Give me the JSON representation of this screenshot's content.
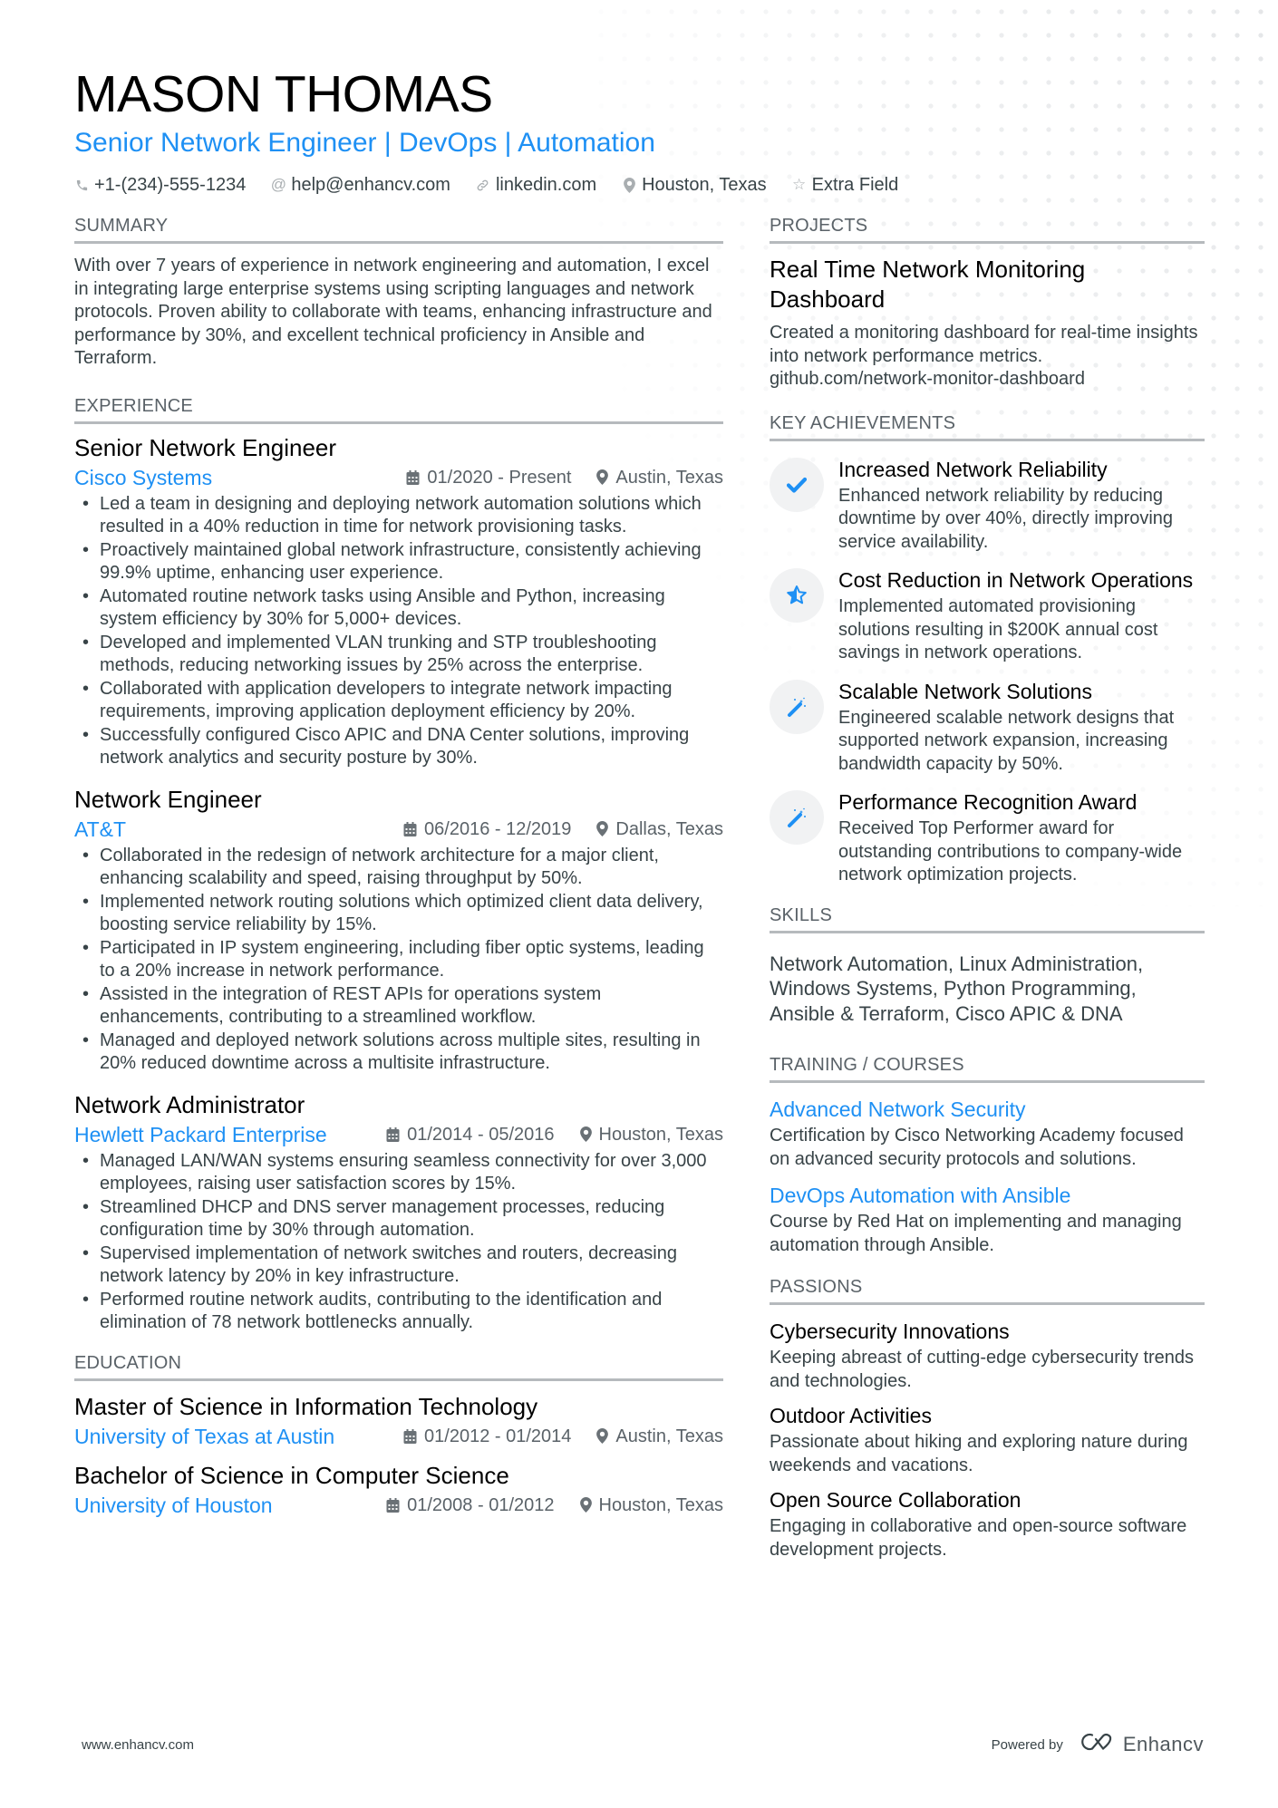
{
  "header": {
    "name": "MASON THOMAS",
    "title": "Senior Network Engineer | DevOps | Automation",
    "contacts": [
      {
        "icon": "phone-icon",
        "text": "+1-(234)-555-1234"
      },
      {
        "icon": "at-icon",
        "text": "help@enhancv.com"
      },
      {
        "icon": "link-icon",
        "text": "linkedin.com"
      },
      {
        "icon": "location-pin-icon",
        "text": "Houston, Texas"
      },
      {
        "icon": "star-outline-icon",
        "text": "Extra Field"
      }
    ]
  },
  "colors": {
    "accent": "#1e90f4",
    "text": "#384347",
    "heading": "#000000",
    "section_rule": "#b6babd",
    "icon_bg": "#f1f2f3"
  },
  "summary": {
    "heading": "Summary",
    "text": "With over 7 years of experience in network engineering and automation, I excel in integrating large enterprise systems using scripting languages and network protocols. Proven ability to collaborate with teams, enhancing infrastructure and performance by 30%, and excellent technical proficiency in Ansible and Terraform."
  },
  "experience": {
    "heading": "Experience",
    "jobs": [
      {
        "title": "Senior Network Engineer",
        "company": "Cisco Systems",
        "dates": "01/2020 - Present",
        "location": "Austin, Texas",
        "bullets": [
          "Led a team in designing and deploying network automation solutions which resulted in a 40% reduction in time for network provisioning tasks.",
          "Proactively maintained global network infrastructure, consistently achieving 99.9% uptime, enhancing user experience.",
          "Automated routine network tasks using Ansible and Python, increasing system efficiency by 30% for 5,000+ devices.",
          "Developed and implemented VLAN trunking and STP troubleshooting methods, reducing networking issues by 25% across the enterprise.",
          "Collaborated with application developers to integrate network impacting requirements, improving application deployment efficiency by 20%.",
          "Successfully configured Cisco APIC and DNA Center solutions, improving network analytics and security posture by 30%."
        ]
      },
      {
        "title": "Network Engineer",
        "company": "AT&T",
        "dates": "06/2016 - 12/2019",
        "location": "Dallas, Texas",
        "bullets": [
          "Collaborated in the redesign of network architecture for a major client, enhancing scalability and speed, raising throughput by 50%.",
          "Implemented network routing solutions which optimized client data delivery, boosting service reliability by 15%.",
          "Participated in IP system engineering, including fiber optic systems, leading to a 20% increase in network performance.",
          "Assisted in the integration of REST APIs for operations system enhancements, contributing to a streamlined workflow.",
          "Managed and deployed network solutions across multiple sites, resulting in 20% reduced downtime across a multisite infrastructure."
        ]
      },
      {
        "title": "Network Administrator",
        "company": "Hewlett Packard Enterprise",
        "dates": "01/2014 - 05/2016",
        "location": "Houston, Texas",
        "bullets": [
          "Managed LAN/WAN systems ensuring seamless connectivity for over 3,000 employees, raising user satisfaction scores by 15%.",
          "Streamlined DHCP and DNS server management processes, reducing configuration time by 30% through automation.",
          "Supervised implementation of network switches and routers, decreasing network latency by 20% in key infrastructure.",
          "Performed routine network audits, contributing to the identification and elimination of 78 network bottlenecks annually."
        ]
      }
    ]
  },
  "education": {
    "heading": "Education",
    "items": [
      {
        "degree": "Master of Science in Information Technology",
        "school": "University of Texas at Austin",
        "dates": "01/2012 - 01/2014",
        "location": "Austin, Texas"
      },
      {
        "degree": "Bachelor of Science in Computer Science",
        "school": "University of Houston",
        "dates": "01/2008 - 01/2012",
        "location": "Houston, Texas"
      }
    ]
  },
  "projects": {
    "heading": "Projects",
    "items": [
      {
        "title": "Real Time Network Monitoring Dashboard",
        "description": "Created a monitoring dashboard for real-time insights into network performance metrics.",
        "link": "github.com/network-monitor-dashboard"
      }
    ]
  },
  "achievements": {
    "heading": "Key Achievements",
    "items": [
      {
        "icon": "checkmark-icon",
        "title": "Increased Network Reliability",
        "description": "Enhanced network reliability by reducing downtime by over 40%, directly improving service availability."
      },
      {
        "icon": "half-star-icon",
        "title": "Cost Reduction in Network Operations",
        "description": "Implemented automated provisioning solutions resulting in $200K annual cost savings in network operations."
      },
      {
        "icon": "magic-wand-icon",
        "title": "Scalable Network Solutions",
        "description": "Engineered scalable network designs that supported network expansion, increasing bandwidth capacity by 50%."
      },
      {
        "icon": "magic-wand-icon",
        "title": "Performance Recognition Award",
        "description": "Received Top Performer award for outstanding contributions to company-wide network optimization projects."
      }
    ]
  },
  "skills": {
    "heading": "Skills",
    "text": "Network Automation, Linux Administration, Windows Systems, Python Programming, Ansible & Terraform, Cisco APIC & DNA"
  },
  "training": {
    "heading": "Training / Courses",
    "items": [
      {
        "title": "Advanced Network Security",
        "description": "Certification by Cisco Networking Academy focused on advanced security protocols and solutions."
      },
      {
        "title": "DevOps Automation with Ansible",
        "description": "Course by Red Hat on implementing and managing automation through Ansible."
      }
    ]
  },
  "passions": {
    "heading": "Passions",
    "items": [
      {
        "title": "Cybersecurity Innovations",
        "description": "Keeping abreast of cutting-edge cybersecurity trends and technologies."
      },
      {
        "title": "Outdoor Activities",
        "description": "Passionate about hiking and exploring nature during weekends and vacations."
      },
      {
        "title": "Open Source Collaboration",
        "description": "Engaging in collaborative and open-source software development projects."
      }
    ]
  },
  "footer": {
    "url": "www.enhancv.com",
    "powered_by": "Powered by",
    "brand": "Enhancv"
  }
}
